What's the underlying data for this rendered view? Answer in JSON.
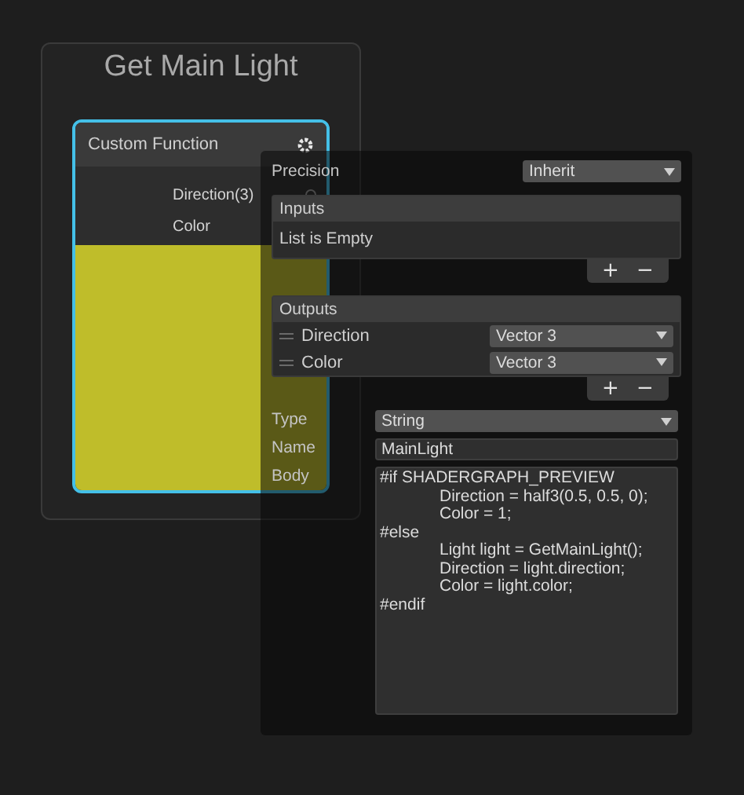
{
  "graph_group": {
    "title": "Get Main Light"
  },
  "node": {
    "title": "Custom Function",
    "ports": [
      {
        "label": "Direction(3)"
      },
      {
        "label": "Color"
      }
    ]
  },
  "inspector": {
    "precision": {
      "label": "Precision",
      "value": "Inherit"
    },
    "inputs": {
      "title": "Inputs",
      "empty_text": "List is Empty",
      "add": "+",
      "remove": "−"
    },
    "outputs": {
      "title": "Outputs",
      "add": "+",
      "remove": "−",
      "rows": [
        {
          "name": "Direction",
          "type": "Vector 3"
        },
        {
          "name": "Color",
          "type": "Vector 3"
        }
      ]
    },
    "type": {
      "label": "Type",
      "value": "String"
    },
    "name": {
      "label": "Name",
      "value": "MainLight"
    },
    "body": {
      "label": "Body",
      "value": "#if SHADERGRAPH_PREVIEW\n\tDirection = half3(0.5, 0.5, 0);\n\tColor = 1;\n#else\n\tLight light = GetMainLight();\n\tDirection = light.direction;\n\tColor = light.color;\n#endif"
    }
  }
}
